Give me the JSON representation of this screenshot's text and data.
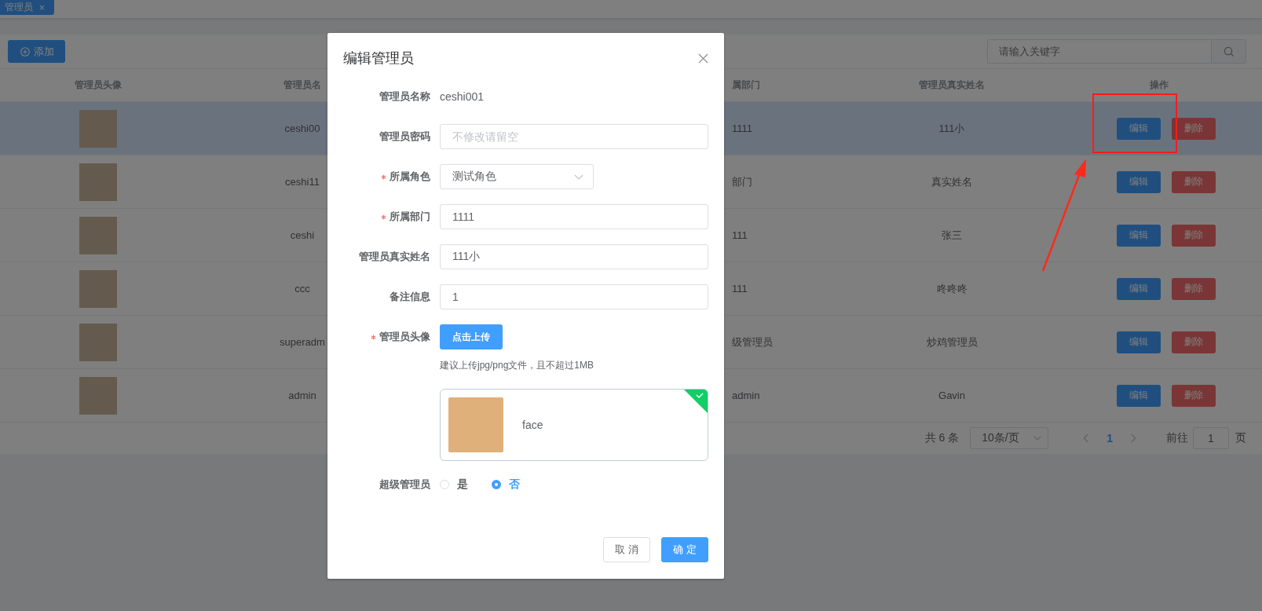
{
  "tabs": [
    {
      "label": "管理员",
      "close": "×",
      "selected": true
    }
  ],
  "toolbar": {
    "add_button": "添加",
    "search": {
      "placeholder": "请输入关键字"
    }
  },
  "table": {
    "columns": [
      "管理员头像",
      "管理员名",
      "属部门",
      "管理员真实姓名",
      "操作"
    ],
    "rows": [
      {
        "name": "ceshi00",
        "department": "1111",
        "real_name": "111小",
        "highlighted": true,
        "edit": "编辑",
        "delete": "删除"
      },
      {
        "name": "ceshi11",
        "department": "部门",
        "real_name": "真实姓名",
        "highlighted": false,
        "edit": "编辑",
        "delete": "删除"
      },
      {
        "name": "ceshi",
        "department": "111",
        "real_name": "张三",
        "highlighted": false,
        "edit": "编辑",
        "delete": "删除"
      },
      {
        "name": "ccc",
        "department": "111",
        "real_name": "咚咚咚",
        "highlighted": false,
        "edit": "编辑",
        "delete": "删除"
      },
      {
        "name": "superadm",
        "department": "级管理员",
        "real_name": "炒鸡管理员",
        "highlighted": false,
        "edit": "编辑",
        "delete": "删除"
      },
      {
        "name": "admin",
        "department": "admin",
        "real_name": "Gavin",
        "highlighted": false,
        "edit": "编辑",
        "delete": "删除"
      }
    ]
  },
  "pagination": {
    "total": "共 6 条",
    "page_size": "10条/页",
    "pages": [
      {
        "label": "1",
        "selected": true
      }
    ],
    "goto_label": "前往",
    "goto_value": "1",
    "goto_suffix": "页"
  },
  "dialog": {
    "title": "编辑管理员",
    "fields": [
      {
        "kind": "text",
        "label": "管理员名称",
        "required": false,
        "value": "ceshi001"
      },
      {
        "kind": "input",
        "label": "管理员密码",
        "required": false,
        "placeholder": "不修改请留空"
      },
      {
        "kind": "select",
        "label": "所属角色",
        "required": true,
        "value": "测试角色"
      },
      {
        "kind": "input",
        "label": "所属部门",
        "required": true,
        "value": "1111"
      },
      {
        "kind": "input",
        "label": "管理员真实姓名",
        "required": false,
        "value": "111小"
      },
      {
        "kind": "input",
        "label": "备注信息",
        "required": false,
        "value": "1"
      },
      {
        "kind": "upload",
        "label": "管理员头像",
        "required": true,
        "button": "点击上传",
        "hint": "建议上传jpg/png文件，且不超过1MB",
        "file": {
          "name": "face",
          "uploaded": true
        }
      },
      {
        "kind": "radio",
        "label": "超级管理员",
        "required": false,
        "options": [
          {
            "label": "是",
            "selected": false
          },
          {
            "label": "否",
            "selected": true
          }
        ]
      }
    ],
    "buttons": {
      "cancel": "取 消",
      "confirm": "确 定"
    }
  }
}
